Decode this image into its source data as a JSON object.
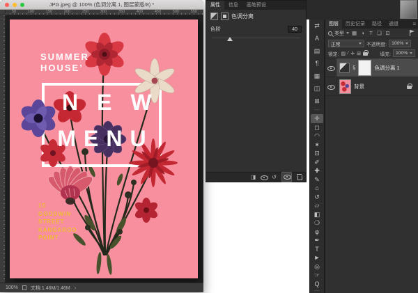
{
  "window": {
    "title": "JPG.jpeg @ 100% (色调分离 1, 图层蒙版/8) *",
    "ruler_numbers": [
      "50",
      "100",
      "150",
      "200",
      "250",
      "300",
      "350",
      "400",
      "450",
      "500",
      "550"
    ],
    "status": {
      "zoom": "100%",
      "doc_info": "文档:1.46M/1.46M",
      "chevron": "›"
    }
  },
  "poster": {
    "brand_line1": "SUMMER",
    "brand_line2": "HOUSE’",
    "headline_top": "NEW",
    "headline_bottom": "MENU",
    "address_line1": "15",
    "address_line2": "GOODWIN",
    "address_line3": "STREET",
    "address_line4": "KANGAROO",
    "address_line5": "POINT",
    "colors": {
      "background": "#f88f9f",
      "address_yellow": "#edbd31",
      "headline_white": "#ffffff"
    }
  },
  "properties_panel": {
    "tab_properties": "属性",
    "tab_info": "信息",
    "tab_presets": "画笔预设",
    "adjustment_title": "色调分离",
    "levels_label": "色阶",
    "levels_value": "40",
    "clip_glyph": "◨",
    "reset_glyph": "↺"
  },
  "top_dock": {
    "collapse_glyph": "⇄",
    "character_glyph": "A",
    "styles_glyph": "▤",
    "paragraph_glyph": "¶",
    "swatches_glyph": "▦",
    "actions_glyph": "◫",
    "adjustments_glyph": "⊞",
    "grip_glyph": "⋯"
  },
  "toolbar": {
    "tools": [
      {
        "name": "move-tool",
        "glyph": "✛"
      },
      {
        "name": "marquee-tool",
        "glyph": "◻"
      },
      {
        "name": "lasso-tool",
        "glyph": "◠"
      },
      {
        "name": "magic-wand-tool",
        "glyph": "✶"
      },
      {
        "name": "crop-tool",
        "glyph": "⊡"
      },
      {
        "name": "eyedropper-tool",
        "glyph": "✐"
      },
      {
        "name": "healing-brush-tool",
        "glyph": "✚"
      },
      {
        "name": "brush-tool",
        "glyph": "✎"
      },
      {
        "name": "clone-stamp-tool",
        "glyph": "⌂"
      },
      {
        "name": "history-brush-tool",
        "glyph": "↺"
      },
      {
        "name": "eraser-tool",
        "glyph": "▱"
      },
      {
        "name": "gradient-tool",
        "glyph": "◧"
      },
      {
        "name": "blur-tool",
        "glyph": "❍"
      },
      {
        "name": "dodge-tool",
        "glyph": "φ"
      },
      {
        "name": "pen-tool",
        "glyph": "✒"
      },
      {
        "name": "type-tool",
        "glyph": "T"
      },
      {
        "name": "path-selection-tool",
        "glyph": "►"
      },
      {
        "name": "shape-tool",
        "glyph": "◎"
      },
      {
        "name": "hand-tool",
        "glyph": "☞"
      },
      {
        "name": "zoom-tool",
        "glyph": "Q"
      }
    ],
    "overflow_glyph": "⋯"
  },
  "layers_panel": {
    "tab_layers": "图层",
    "tab_history": "历史记录",
    "tab_paths": "路径",
    "tab_channels": "通道",
    "menu_glyph": "≡",
    "filter_label": "类型",
    "filter_pixel_glyph": "▦",
    "filter_adjustment_glyph": "◑",
    "filter_type_glyph": "T",
    "filter_shape_glyph": "❏",
    "filter_smart_glyph": "⊡",
    "blend_mode": "正常",
    "opacity_label": "不透明度:",
    "opacity_value": "100%",
    "lock_label": "锁定:",
    "lock_transparency_glyph": "▨",
    "lock_pixels_glyph": "∕",
    "lock_position_glyph": "✛",
    "lock_artboard_glyph": "⊞",
    "fill_label": "填充:",
    "fill_value": "100%",
    "layer1_name": "色调分离 1",
    "layer1_link_glyph": "§",
    "layer2_name": "背景"
  }
}
